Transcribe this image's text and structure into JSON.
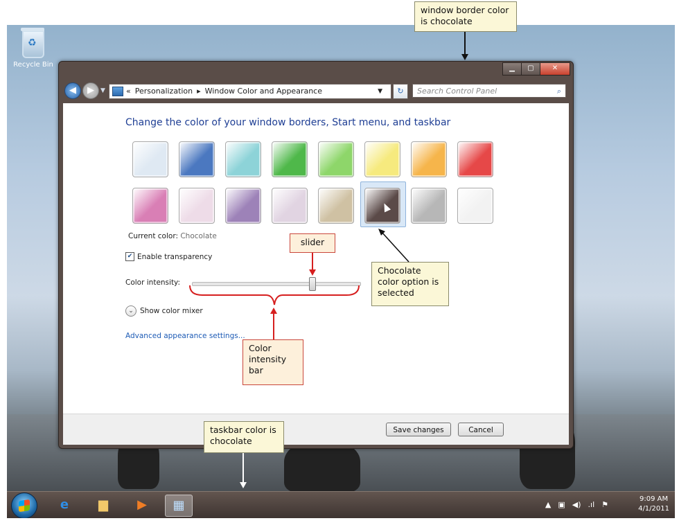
{
  "desktop": {
    "recycle_bin_label": "Recycle Bin"
  },
  "window": {
    "address_path": [
      "«",
      "Personalization",
      "▸",
      "Window Color and Appearance"
    ],
    "search_placeholder": "Search Control Panel",
    "heading": "Change the color of your window borders, Start menu, and taskbar",
    "swatch_colors": [
      [
        "#dfe9f3",
        "#4b78c0",
        "#8dd3d8",
        "#4fb84a",
        "#8ed66a",
        "#f6ea7e",
        "#f6b54b",
        "#e64848"
      ],
      [
        "#d97fb5",
        "#eedce8",
        "#9d82b8",
        "#e1d4e2",
        "#cfc1a3",
        "#5b4a48",
        "#b7b7b7",
        "#f2f2f2"
      ]
    ],
    "selected_swatch": {
      "row": 1,
      "col": 5
    },
    "current_color_label": "Current color:",
    "current_color_value": "Chocolate",
    "enable_transparency_label": "Enable transparency",
    "enable_transparency_checked": true,
    "color_intensity_label": "Color intensity:",
    "color_intensity_value": 0.72,
    "show_color_mixer_label": "Show color mixer",
    "advanced_link": "Advanced appearance settings...",
    "save_label": "Save changes",
    "cancel_label": "Cancel"
  },
  "taskbar": {
    "clock_time": "9:09 AM",
    "clock_date": "4/1/2011"
  },
  "callouts": {
    "window_border": "window border color is chocolate",
    "slider": "slider",
    "chocolate": "Chocolate color option is selected",
    "intensity_bar": "Color intensity bar",
    "taskbar": "taskbar color is chocolate"
  }
}
